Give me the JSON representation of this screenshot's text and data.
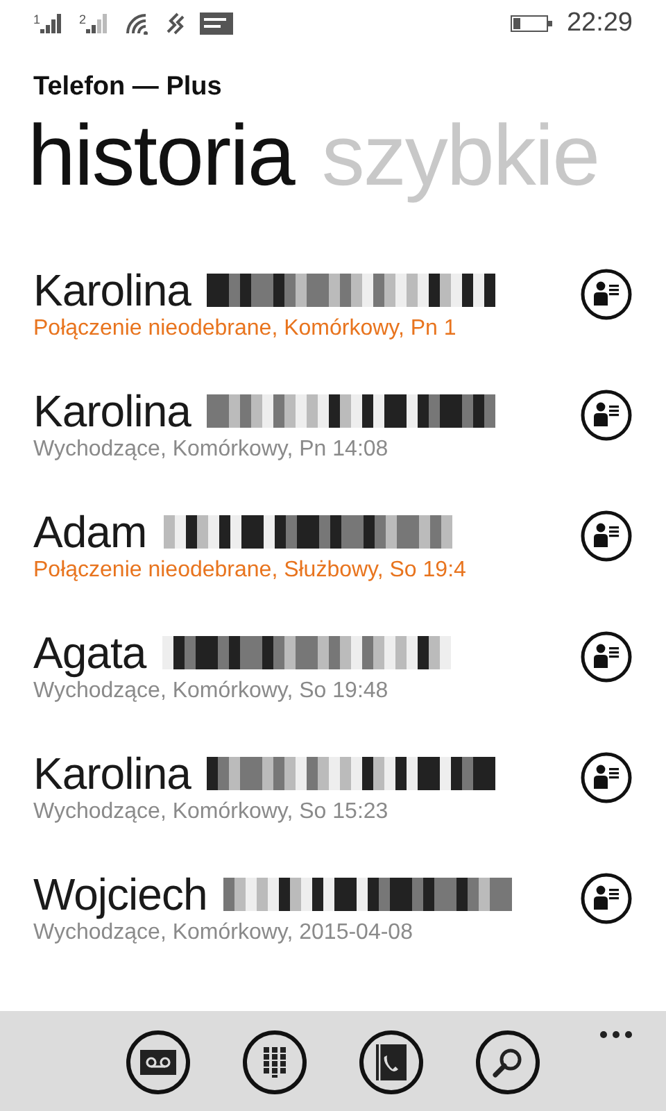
{
  "status_bar": {
    "sim_1": "1",
    "sim_2": "2",
    "time": "22:29"
  },
  "app_title": "Telefon — Plus",
  "pivots": [
    {
      "label": "historia",
      "selected": true
    },
    {
      "label": "szybkie",
      "selected": false
    }
  ],
  "calls": [
    {
      "first_name": "Karolina",
      "surname_redacted": true,
      "detail": "Połączenie nieodebrane, Komórkowy, Pn 1",
      "missed": true
    },
    {
      "first_name": "Karolina",
      "surname_redacted": true,
      "detail": "Wychodzące, Komórkowy, Pn 14:08",
      "missed": false
    },
    {
      "first_name": "Adam",
      "surname_redacted": true,
      "detail": "Połączenie nieodebrane, Służbowy, So 19:4",
      "missed": true
    },
    {
      "first_name": "Agata",
      "surname_redacted": true,
      "detail": "Wychodzące, Komórkowy, So 19:48",
      "missed": false
    },
    {
      "first_name": "Karolina",
      "surname_redacted": true,
      "detail": "Wychodzące, Komórkowy, So 15:23",
      "missed": false
    },
    {
      "first_name": "Wojciech",
      "surname_redacted": true,
      "detail": "Wychodzące, Komórkowy, 2015-04-08",
      "missed": false
    }
  ],
  "app_bar": {
    "buttons": [
      {
        "kind": "voicemail"
      },
      {
        "kind": "keypad"
      },
      {
        "kind": "contacts"
      },
      {
        "kind": "search"
      }
    ]
  }
}
